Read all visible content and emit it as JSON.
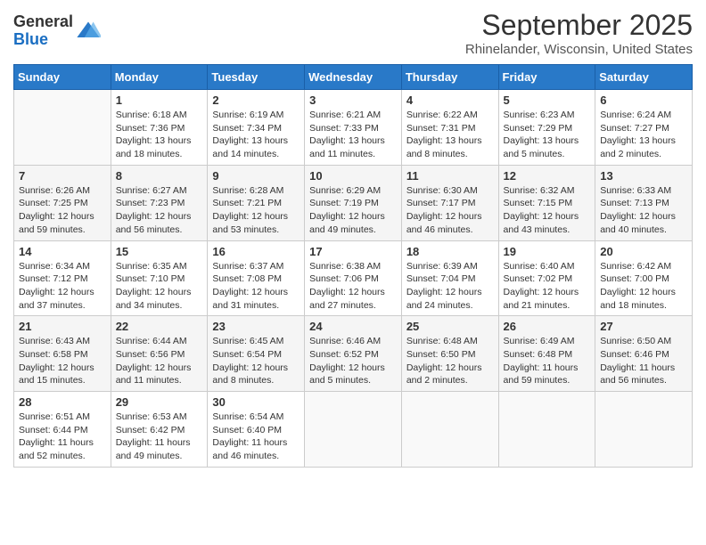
{
  "header": {
    "logo_general": "General",
    "logo_blue": "Blue",
    "month_title": "September 2025",
    "location": "Rhinelander, Wisconsin, United States"
  },
  "days_of_week": [
    "Sunday",
    "Monday",
    "Tuesday",
    "Wednesday",
    "Thursday",
    "Friday",
    "Saturday"
  ],
  "weeks": [
    [
      {
        "num": "",
        "sunrise": "",
        "sunset": "",
        "daylight": ""
      },
      {
        "num": "1",
        "sunrise": "Sunrise: 6:18 AM",
        "sunset": "Sunset: 7:36 PM",
        "daylight": "Daylight: 13 hours and 18 minutes."
      },
      {
        "num": "2",
        "sunrise": "Sunrise: 6:19 AM",
        "sunset": "Sunset: 7:34 PM",
        "daylight": "Daylight: 13 hours and 14 minutes."
      },
      {
        "num": "3",
        "sunrise": "Sunrise: 6:21 AM",
        "sunset": "Sunset: 7:33 PM",
        "daylight": "Daylight: 13 hours and 11 minutes."
      },
      {
        "num": "4",
        "sunrise": "Sunrise: 6:22 AM",
        "sunset": "Sunset: 7:31 PM",
        "daylight": "Daylight: 13 hours and 8 minutes."
      },
      {
        "num": "5",
        "sunrise": "Sunrise: 6:23 AM",
        "sunset": "Sunset: 7:29 PM",
        "daylight": "Daylight: 13 hours and 5 minutes."
      },
      {
        "num": "6",
        "sunrise": "Sunrise: 6:24 AM",
        "sunset": "Sunset: 7:27 PM",
        "daylight": "Daylight: 13 hours and 2 minutes."
      }
    ],
    [
      {
        "num": "7",
        "sunrise": "Sunrise: 6:26 AM",
        "sunset": "Sunset: 7:25 PM",
        "daylight": "Daylight: 12 hours and 59 minutes."
      },
      {
        "num": "8",
        "sunrise": "Sunrise: 6:27 AM",
        "sunset": "Sunset: 7:23 PM",
        "daylight": "Daylight: 12 hours and 56 minutes."
      },
      {
        "num": "9",
        "sunrise": "Sunrise: 6:28 AM",
        "sunset": "Sunset: 7:21 PM",
        "daylight": "Daylight: 12 hours and 53 minutes."
      },
      {
        "num": "10",
        "sunrise": "Sunrise: 6:29 AM",
        "sunset": "Sunset: 7:19 PM",
        "daylight": "Daylight: 12 hours and 49 minutes."
      },
      {
        "num": "11",
        "sunrise": "Sunrise: 6:30 AM",
        "sunset": "Sunset: 7:17 PM",
        "daylight": "Daylight: 12 hours and 46 minutes."
      },
      {
        "num": "12",
        "sunrise": "Sunrise: 6:32 AM",
        "sunset": "Sunset: 7:15 PM",
        "daylight": "Daylight: 12 hours and 43 minutes."
      },
      {
        "num": "13",
        "sunrise": "Sunrise: 6:33 AM",
        "sunset": "Sunset: 7:13 PM",
        "daylight": "Daylight: 12 hours and 40 minutes."
      }
    ],
    [
      {
        "num": "14",
        "sunrise": "Sunrise: 6:34 AM",
        "sunset": "Sunset: 7:12 PM",
        "daylight": "Daylight: 12 hours and 37 minutes."
      },
      {
        "num": "15",
        "sunrise": "Sunrise: 6:35 AM",
        "sunset": "Sunset: 7:10 PM",
        "daylight": "Daylight: 12 hours and 34 minutes."
      },
      {
        "num": "16",
        "sunrise": "Sunrise: 6:37 AM",
        "sunset": "Sunset: 7:08 PM",
        "daylight": "Daylight: 12 hours and 31 minutes."
      },
      {
        "num": "17",
        "sunrise": "Sunrise: 6:38 AM",
        "sunset": "Sunset: 7:06 PM",
        "daylight": "Daylight: 12 hours and 27 minutes."
      },
      {
        "num": "18",
        "sunrise": "Sunrise: 6:39 AM",
        "sunset": "Sunset: 7:04 PM",
        "daylight": "Daylight: 12 hours and 24 minutes."
      },
      {
        "num": "19",
        "sunrise": "Sunrise: 6:40 AM",
        "sunset": "Sunset: 7:02 PM",
        "daylight": "Daylight: 12 hours and 21 minutes."
      },
      {
        "num": "20",
        "sunrise": "Sunrise: 6:42 AM",
        "sunset": "Sunset: 7:00 PM",
        "daylight": "Daylight: 12 hours and 18 minutes."
      }
    ],
    [
      {
        "num": "21",
        "sunrise": "Sunrise: 6:43 AM",
        "sunset": "Sunset: 6:58 PM",
        "daylight": "Daylight: 12 hours and 15 minutes."
      },
      {
        "num": "22",
        "sunrise": "Sunrise: 6:44 AM",
        "sunset": "Sunset: 6:56 PM",
        "daylight": "Daylight: 12 hours and 11 minutes."
      },
      {
        "num": "23",
        "sunrise": "Sunrise: 6:45 AM",
        "sunset": "Sunset: 6:54 PM",
        "daylight": "Daylight: 12 hours and 8 minutes."
      },
      {
        "num": "24",
        "sunrise": "Sunrise: 6:46 AM",
        "sunset": "Sunset: 6:52 PM",
        "daylight": "Daylight: 12 hours and 5 minutes."
      },
      {
        "num": "25",
        "sunrise": "Sunrise: 6:48 AM",
        "sunset": "Sunset: 6:50 PM",
        "daylight": "Daylight: 12 hours and 2 minutes."
      },
      {
        "num": "26",
        "sunrise": "Sunrise: 6:49 AM",
        "sunset": "Sunset: 6:48 PM",
        "daylight": "Daylight: 11 hours and 59 minutes."
      },
      {
        "num": "27",
        "sunrise": "Sunrise: 6:50 AM",
        "sunset": "Sunset: 6:46 PM",
        "daylight": "Daylight: 11 hours and 56 minutes."
      }
    ],
    [
      {
        "num": "28",
        "sunrise": "Sunrise: 6:51 AM",
        "sunset": "Sunset: 6:44 PM",
        "daylight": "Daylight: 11 hours and 52 minutes."
      },
      {
        "num": "29",
        "sunrise": "Sunrise: 6:53 AM",
        "sunset": "Sunset: 6:42 PM",
        "daylight": "Daylight: 11 hours and 49 minutes."
      },
      {
        "num": "30",
        "sunrise": "Sunrise: 6:54 AM",
        "sunset": "Sunset: 6:40 PM",
        "daylight": "Daylight: 11 hours and 46 minutes."
      },
      {
        "num": "",
        "sunrise": "",
        "sunset": "",
        "daylight": ""
      },
      {
        "num": "",
        "sunrise": "",
        "sunset": "",
        "daylight": ""
      },
      {
        "num": "",
        "sunrise": "",
        "sunset": "",
        "daylight": ""
      },
      {
        "num": "",
        "sunrise": "",
        "sunset": "",
        "daylight": ""
      }
    ]
  ]
}
